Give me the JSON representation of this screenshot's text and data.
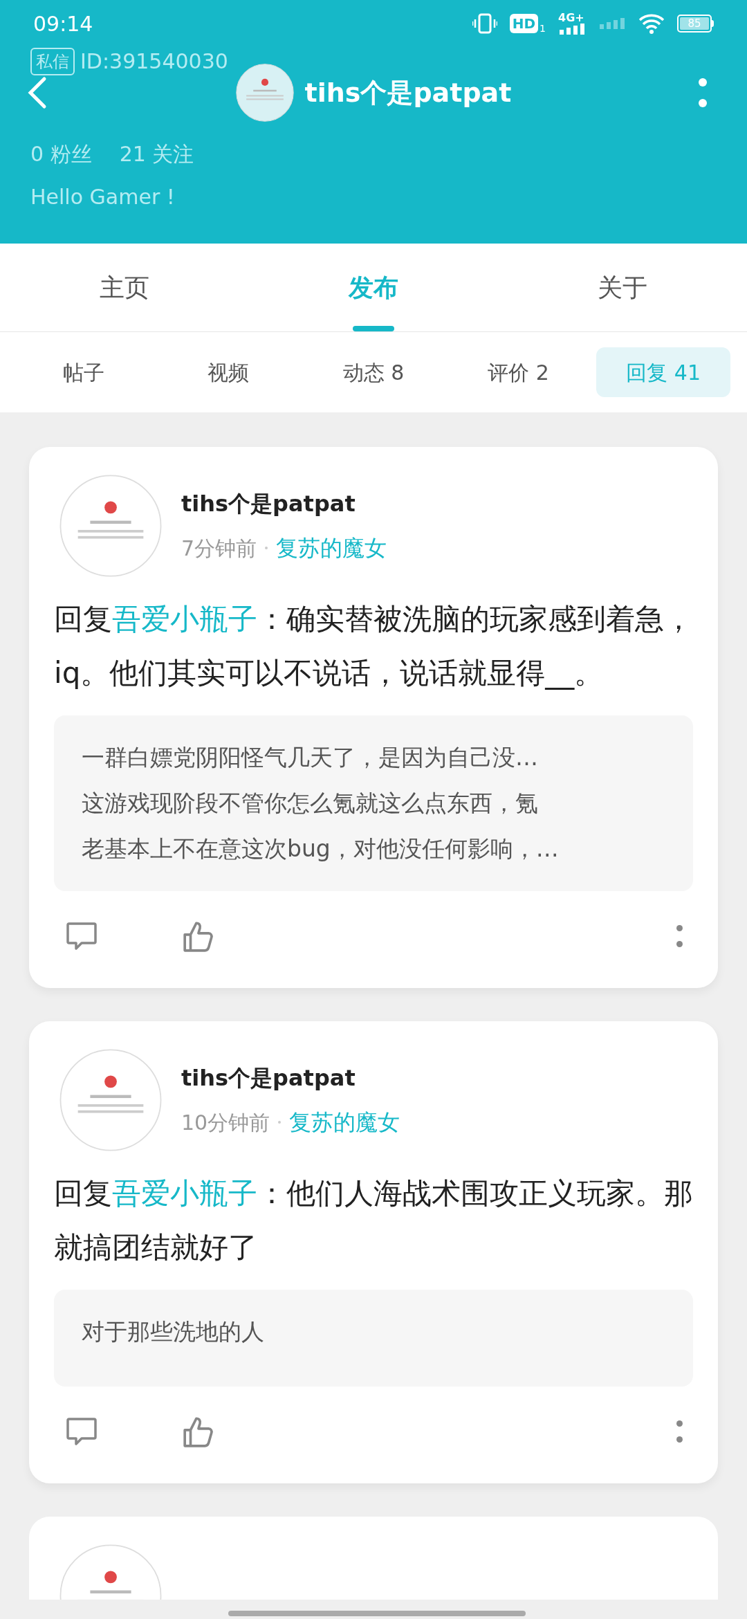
{
  "status_bar": {
    "time": "09:14",
    "hd_label": "HD",
    "sim_slot": "1",
    "network": "4G+",
    "battery": "85"
  },
  "faded_profile": {
    "badge": "私信",
    "id": "ID:391540030",
    "stats": [
      {
        "count": "0",
        "label": "粉丝"
      },
      {
        "count": "21",
        "label": "关注"
      }
    ],
    "greeting": "Hello Gamer !"
  },
  "header": {
    "title": "tihs个是patpat"
  },
  "tabs": [
    {
      "label": "主页",
      "selected": false
    },
    {
      "label": "发布",
      "selected": true
    },
    {
      "label": "关于",
      "selected": false
    }
  ],
  "sub_tabs": [
    {
      "label": "帖子",
      "selected": false
    },
    {
      "label": "视频",
      "selected": false
    },
    {
      "label": "动态 8",
      "selected": false
    },
    {
      "label": "评价 2",
      "selected": false
    },
    {
      "label": "回复 41",
      "selected": true
    }
  ],
  "posts": [
    {
      "author": "tihs个是patpat",
      "time": "7分钟前",
      "game": "复苏的魔女",
      "reply_prefix": "回复",
      "reply_to": "吾爱小瓶子",
      "reply_colon": "：",
      "text": "确实替被洗脑的玩家感到着急，iq。他们其实可以不说话，说话就显得__。",
      "quote": [
        "一群白嫖党阴阳怪气几天了，是因为自己没…",
        "这游戏现阶段不管你怎么氪就这么点东西，氪",
        "老基本上不在意这次bug，对他没任何影响，…"
      ]
    },
    {
      "author": "tihs个是patpat",
      "time": "10分钟前",
      "game": "复苏的魔女",
      "reply_prefix": "回复",
      "reply_to": "吾爱小瓶子",
      "reply_colon": "：",
      "text": "他们人海战术围攻正义玩家。那就搞团结就好了",
      "quote": [
        "对于那些洗地的人"
      ]
    },
    {
      "kind": "partial"
    }
  ]
}
